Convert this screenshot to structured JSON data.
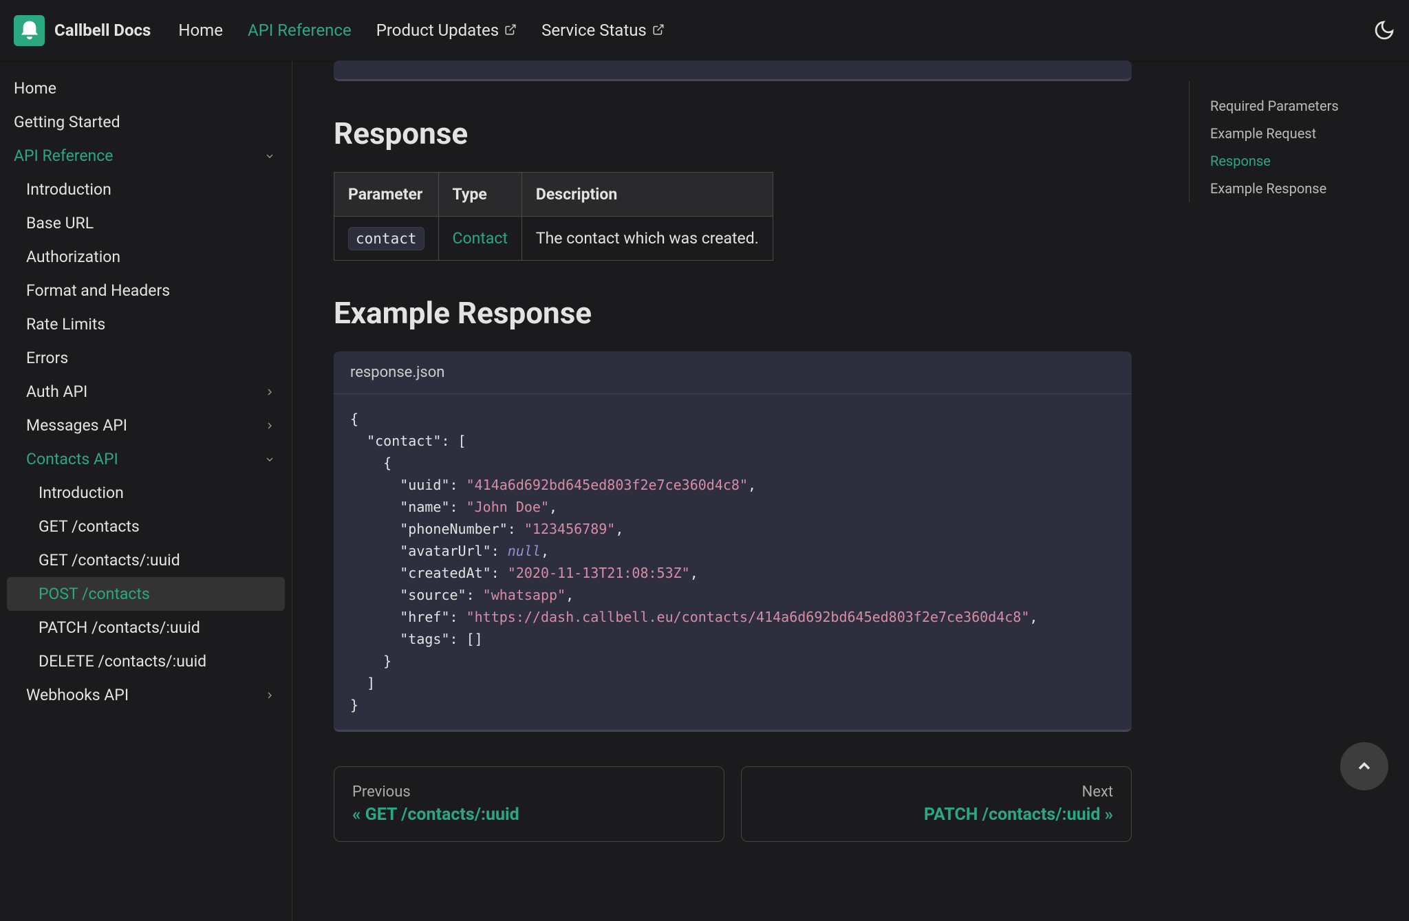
{
  "brand": "Callbell Docs",
  "nav": {
    "home": "Home",
    "api_reference": "API Reference",
    "product_updates": "Product Updates",
    "service_status": "Service Status"
  },
  "sidebar": {
    "home": "Home",
    "getting_started": "Getting Started",
    "api_reference": "API Reference",
    "introduction": "Introduction",
    "base_url": "Base URL",
    "authorization": "Authorization",
    "format_headers": "Format and Headers",
    "rate_limits": "Rate Limits",
    "errors": "Errors",
    "auth_api": "Auth API",
    "messages_api": "Messages API",
    "contacts_api": "Contacts API",
    "contacts_intro": "Introduction",
    "get_contacts": "GET /contacts",
    "get_contacts_uuid": "GET /contacts/:uuid",
    "post_contacts": "POST /contacts",
    "patch_contacts": "PATCH /contacts/:uuid",
    "delete_contacts": "DELETE /contacts/:uuid",
    "webhooks_api": "Webhooks API"
  },
  "main": {
    "response_heading": "Response",
    "table": {
      "th_param": "Parameter",
      "th_type": "Type",
      "th_desc": "Description",
      "row_param": "contact",
      "row_type": "Contact",
      "row_desc": "The contact which was created."
    },
    "example_heading": "Example Response",
    "code_filename": "response.json",
    "json": {
      "uuid": "\"414a6d692bd645ed803f2e7ce360d4c8\"",
      "name": "\"John Doe\"",
      "phoneNumber": "\"123456789\"",
      "avatarUrl": "null",
      "createdAt": "\"2020-11-13T21:08:53Z\"",
      "source": "\"whatsapp\"",
      "href": "\"https://dash.callbell.eu/contacts/414a6d692bd645ed803f2e7ce360d4c8\"",
      "tags": "[]"
    }
  },
  "pagination": {
    "prev_label": "Previous",
    "prev_title": "« GET /contacts/:uuid",
    "next_label": "Next",
    "next_title": "PATCH /contacts/:uuid »"
  },
  "toc": {
    "required_params": "Required Parameters",
    "example_request": "Example Request",
    "response": "Response",
    "example_response": "Example Response"
  }
}
